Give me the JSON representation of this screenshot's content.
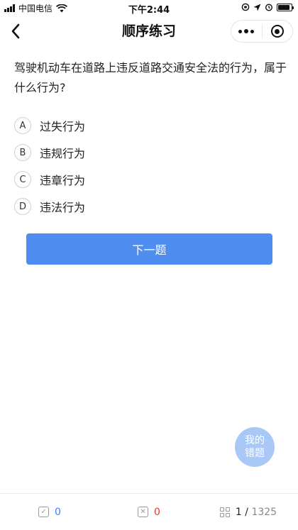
{
  "status_bar": {
    "carrier": "中国电信",
    "time": "下午2:44",
    "battery_level": 0.9
  },
  "nav": {
    "title": "顺序练习",
    "back_icon": "chevron-left-icon",
    "more_icon": "more-dots-icon",
    "close_icon": "target-circle-icon"
  },
  "question": {
    "text": "驾驶机动车在道路上违反道路交通安全法的行为，属于什么行为?"
  },
  "options": [
    {
      "letter": "A",
      "text": "过失行为"
    },
    {
      "letter": "B",
      "text": "违规行为"
    },
    {
      "letter": "C",
      "text": "违章行为"
    },
    {
      "letter": "D",
      "text": "违法行为"
    }
  ],
  "next_button": {
    "label": "下一题"
  },
  "fab": {
    "line1": "我的",
    "line2": "错题"
  },
  "bottom_bar": {
    "correct_count": "0",
    "wrong_count": "0",
    "progress_current": "1",
    "progress_separator": " / ",
    "progress_total": "1325"
  },
  "colors": {
    "primary": "#4f8ef0",
    "fab": "#aac8f5",
    "correct": "#3b82f6",
    "wrong": "#e53935"
  }
}
